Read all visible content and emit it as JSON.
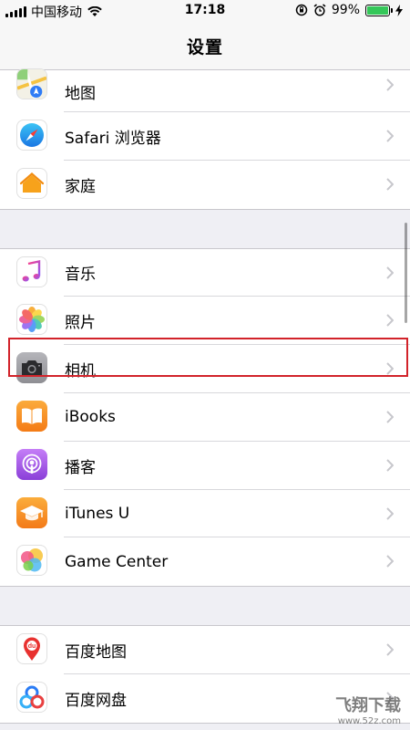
{
  "status_bar": {
    "carrier": "中国移动",
    "time": "17:18",
    "battery_percent": "99%",
    "battery_level": 0.99
  },
  "nav": {
    "title": "设置"
  },
  "groups": [
    {
      "items": [
        {
          "name": "maps",
          "label": "地图",
          "icon": "maps-icon"
        },
        {
          "name": "safari",
          "label": "Safari 浏览器",
          "icon": "safari-icon"
        },
        {
          "name": "home",
          "label": "家庭",
          "icon": "home-icon"
        }
      ]
    },
    {
      "items": [
        {
          "name": "music",
          "label": "音乐",
          "icon": "music-icon"
        },
        {
          "name": "photos",
          "label": "照片",
          "icon": "photos-icon"
        },
        {
          "name": "camera",
          "label": "相机",
          "icon": "camera-icon"
        },
        {
          "name": "ibooks",
          "label": "iBooks",
          "icon": "ibooks-icon"
        },
        {
          "name": "podcasts",
          "label": "播客",
          "icon": "podcasts-icon"
        },
        {
          "name": "itunes-u",
          "label": "iTunes U",
          "icon": "itunes-u-icon"
        },
        {
          "name": "game-center",
          "label": "Game Center",
          "icon": "game-center-icon"
        }
      ]
    },
    {
      "items": [
        {
          "name": "baidu-maps",
          "label": "百度地图",
          "icon": "baidu-maps-icon"
        },
        {
          "name": "baidu-netdisk",
          "label": "百度网盘",
          "icon": "baidu-netdisk-icon"
        }
      ]
    }
  ],
  "highlighted_item": "camera",
  "watermark": {
    "title": "飞翔下载",
    "url": "www.52z.com"
  },
  "colors": {
    "highlight": "#d2232a",
    "battery": "#34c759",
    "background": "#efeff4"
  }
}
